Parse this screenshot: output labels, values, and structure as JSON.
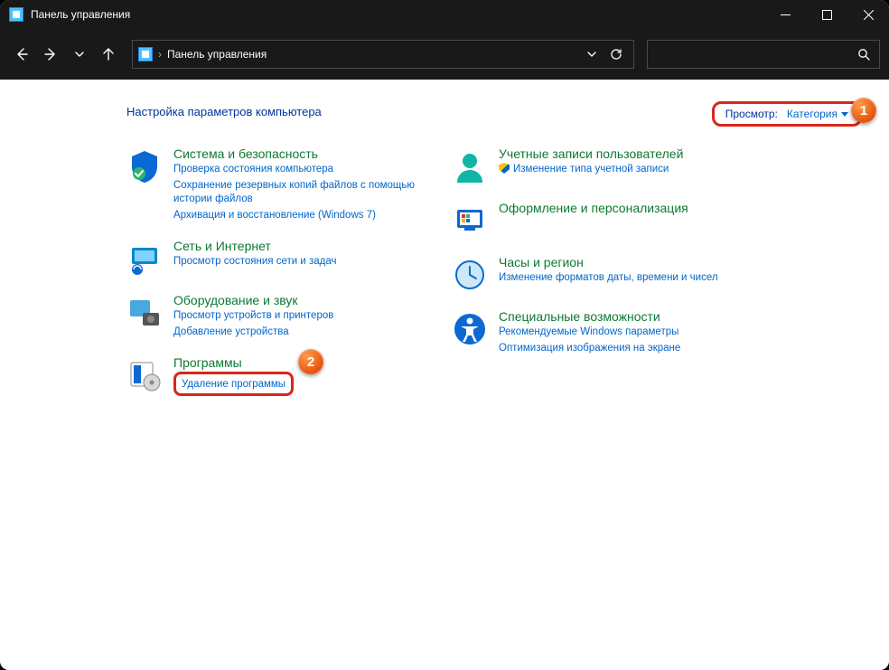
{
  "window": {
    "title": "Панель управления"
  },
  "address": {
    "text": "Панель управления"
  },
  "search": {
    "placeholder": ""
  },
  "page": {
    "title": "Настройка параметров компьютера"
  },
  "viewby": {
    "label": "Просмотр:",
    "value": "Категория"
  },
  "callouts": {
    "one": "1",
    "two": "2"
  },
  "cats": {
    "system": {
      "title": "Система и безопасность",
      "links": [
        "Проверка состояния компьютера",
        "Сохранение резервных копий файлов с помощью истории файлов",
        "Архивация и восстановление (Windows 7)"
      ]
    },
    "network": {
      "title": "Сеть и Интернет",
      "links": [
        "Просмотр состояния сети и задач"
      ]
    },
    "hardware": {
      "title": "Оборудование и звук",
      "links": [
        "Просмотр устройств и принтеров",
        "Добавление устройства"
      ]
    },
    "programs": {
      "title": "Программы",
      "links": [
        "Удаление программы"
      ]
    },
    "users": {
      "title": "Учетные записи пользователей",
      "links": [
        "Изменение типа учетной записи"
      ]
    },
    "appearance": {
      "title": "Оформление и персонализация"
    },
    "clock": {
      "title": "Часы и регион",
      "links": [
        "Изменение форматов даты, времени и чисел"
      ]
    },
    "ease": {
      "title": "Специальные возможности",
      "links": [
        "Рекомендуемые Windows параметры",
        "Оптимизация изображения на экране"
      ]
    }
  }
}
